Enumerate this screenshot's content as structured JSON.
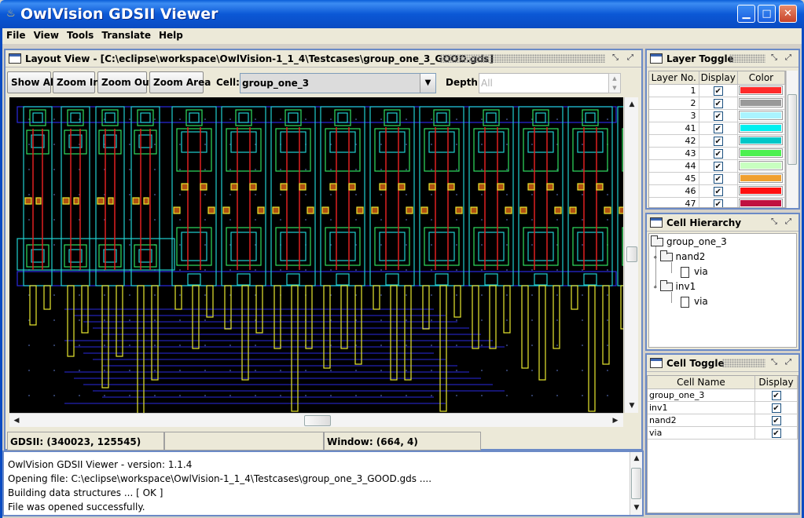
{
  "window": {
    "title": "OwlVision GDSII Viewer",
    "min_glyph": "▁",
    "max_glyph": "□",
    "close_glyph": "✕"
  },
  "menu": [
    "File",
    "View",
    "Tools",
    "Translate",
    "Help"
  ],
  "layout_view": {
    "title": "Layout View - [C:\\eclipse\\workspace\\OwlVision-1_1_4\\Testcases\\group_one_3_GOOD.gds]",
    "toolbar": {
      "show_all": "Show All",
      "zoom_in": "Zoom In",
      "zoom_out": "Zoom Out",
      "zoom_area": "Zoom Area",
      "cell_label": "Cell:",
      "cell_value": "group_one_3",
      "depth_label": "Depth:",
      "depth_value": "All"
    },
    "status": {
      "gdsii": "GDSII: (340023, 125545)",
      "window": "Window: (664, 4)"
    }
  },
  "layer_toggle": {
    "title": "Layer Toggle",
    "columns": [
      "Layer No.",
      "Display",
      "Color"
    ],
    "rows": [
      {
        "layer": "1",
        "display": true,
        "color": "#ff2a2a"
      },
      {
        "layer": "2",
        "display": true,
        "color": "#999999"
      },
      {
        "layer": "3",
        "display": true,
        "color": "#aaf4ff"
      },
      {
        "layer": "41",
        "display": true,
        "color": "#00f0f0"
      },
      {
        "layer": "42",
        "display": true,
        "color": "#00c8c8"
      },
      {
        "layer": "43",
        "display": true,
        "color": "#4cf050"
      },
      {
        "layer": "44",
        "display": true,
        "color": "#c8ffc0"
      },
      {
        "layer": "45",
        "display": true,
        "color": "#f0a030"
      },
      {
        "layer": "46",
        "display": true,
        "color": "#ff1010"
      },
      {
        "layer": "47",
        "display": true,
        "color": "#c01040"
      }
    ]
  },
  "cell_hierarchy": {
    "title": "Cell Hierarchy",
    "root": "group_one_3",
    "nand2": "nand2",
    "nand2_child": "via",
    "inv1": "inv1",
    "inv1_child": "via"
  },
  "cell_toggle": {
    "title": "Cell Toggle",
    "columns": [
      "Cell Name",
      "Display"
    ],
    "rows": [
      {
        "name": "group_one_3",
        "display": true
      },
      {
        "name": "inv1",
        "display": true
      },
      {
        "name": "nand2",
        "display": true
      },
      {
        "name": "via",
        "display": true
      }
    ]
  },
  "log": [
    "OwlVision GDSII Viewer - version: 1.1.4",
    "Opening file: C:\\eclipse\\workspace\\OwlVision-1_1_4\\Testcases\\group_one_3_GOOD.gds ....",
    "Building data structures ...  [ OK ]",
    "File was opened successfully."
  ],
  "colors": {
    "wire_blue": "#2a2ae0",
    "poly_red": "#e02020",
    "metal_yellow": "#e8e830",
    "cell_cyan": "#20d0d0",
    "active_green": "#30e060"
  }
}
